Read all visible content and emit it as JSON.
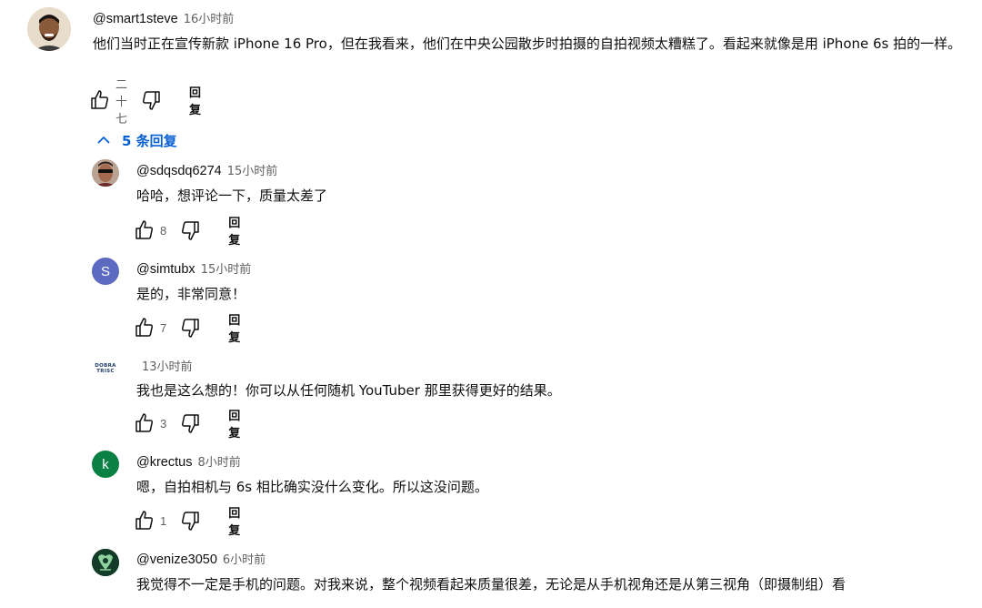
{
  "top_comment": {
    "handle": "@smart1steve",
    "time": "16小时前",
    "text": "他们当时正在宣传新款 iPhone 16 Pro，但在我看来，他们在中央公园散步时拍摄的自拍视频太糟糕了。看起来就像是用 iPhone 6s 拍的一样。",
    "likes": "二十七",
    "reply_label": "回复"
  },
  "replies_toggle": {
    "label": "5 条回复"
  },
  "replies": [
    {
      "handle": "@sdqsdq6274",
      "time": "15小时前",
      "text": "哈哈，想评论一下，质量太差了",
      "likes": "8",
      "reply_label": "回复",
      "avatar_icon": "person-sunglasses-avatar"
    },
    {
      "handle": "@simtubx",
      "time": "15小时前",
      "text": "是的，非常同意！",
      "likes": "7",
      "reply_label": "回复",
      "avatar_letter": "S",
      "avatar_color": "#5c6bc0"
    },
    {
      "handle": "",
      "time": "13小时前",
      "text": "我也是这么想的！你可以从任何随机 YouTuber 那里获得更好的结果。",
      "likes": "3",
      "reply_label": "回复",
      "avatar_logo_line1": "DOBRA",
      "avatar_logo_line2": "TRISC"
    },
    {
      "handle": "@krectus",
      "time": "8小时前",
      "text": "嗯，自拍相机与 6s 相比确实没什么变化。所以这没问题。",
      "likes": "1",
      "reply_label": "回复",
      "avatar_letter": "k",
      "avatar_color": "#0b8043"
    },
    {
      "handle": "@venize3050",
      "time": "6小时前",
      "text": "我觉得不一定是手机的问题。对我来说，整个视频看起来质量很差，无论是从手机视角还是从第三视角（即摄制组）看",
      "likes": "",
      "reply_label": "",
      "avatar_icon": "green-emblem-avatar"
    }
  ],
  "colors": {
    "link_blue": "#065fd4",
    "meta_gray": "#606060"
  }
}
